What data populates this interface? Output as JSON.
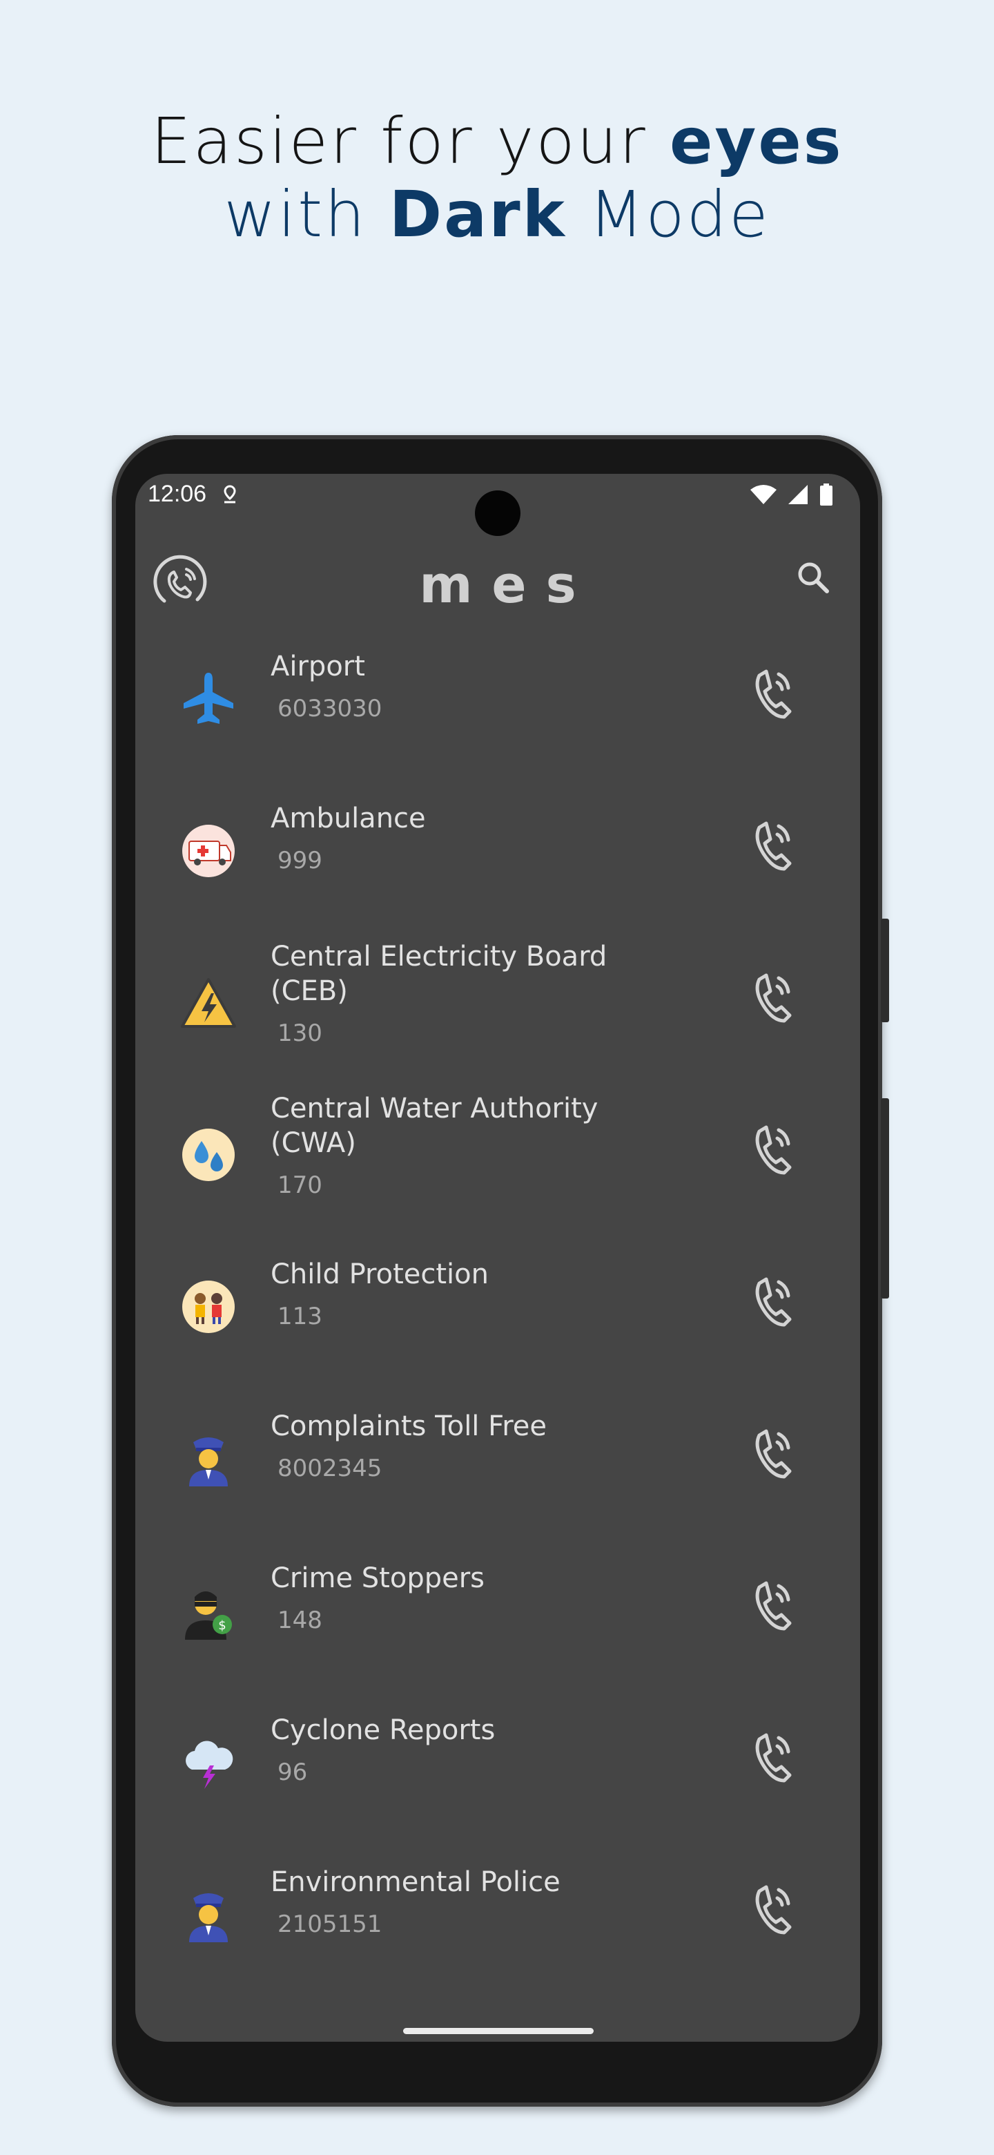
{
  "promo": {
    "line1_pre": "Easier for your ",
    "line1_bold": "eyes",
    "line2_pre": "with ",
    "line2_bold": "Dark",
    "line2_post": " Mode"
  },
  "status_bar": {
    "time": "12:06"
  },
  "app": {
    "title": "mes"
  },
  "icons": {
    "logo": "phone-ring-logo-icon",
    "search": "search-icon",
    "call": "phone-call-icon"
  },
  "colors": {
    "background": "#e8f1f8",
    "headline_dark": "#151515",
    "headline_blue": "#0d3a66",
    "screen_bg": "#454545"
  },
  "contacts": [
    {
      "name": "Airport",
      "number": "6033030",
      "icon": "airplane-icon"
    },
    {
      "name": "Ambulance",
      "number": "999",
      "icon": "ambulance-icon"
    },
    {
      "name": "Central Electricity Board (CEB)",
      "number": "130",
      "icon": "high-voltage-icon"
    },
    {
      "name": "Central Water Authority (CWA)",
      "number": "170",
      "icon": "water-drops-icon"
    },
    {
      "name": "Child Protection",
      "number": "113",
      "icon": "children-icon"
    },
    {
      "name": "Complaints Toll Free",
      "number": "8002345",
      "icon": "police-officer-icon"
    },
    {
      "name": "Crime Stoppers",
      "number": "148",
      "icon": "thief-icon"
    },
    {
      "name": "Cyclone Reports",
      "number": "96",
      "icon": "storm-cloud-icon"
    },
    {
      "name": "Environmental Police",
      "number": "2105151",
      "icon": "police-officer-icon"
    }
  ]
}
